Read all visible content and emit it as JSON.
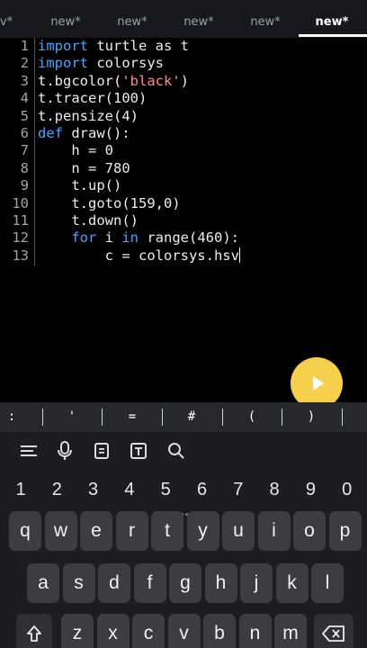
{
  "tabs": [
    {
      "label": "v*"
    },
    {
      "label": "new*"
    },
    {
      "label": "new*"
    },
    {
      "label": "new*"
    },
    {
      "label": "new*"
    },
    {
      "label": "new*",
      "active": true
    }
  ],
  "editor": {
    "lines": [
      {
        "n": "1",
        "parts": [
          {
            "t": "import",
            "c": "kw"
          },
          {
            "t": " turtle as t"
          }
        ]
      },
      {
        "n": "2",
        "parts": [
          {
            "t": "import",
            "c": "kw"
          },
          {
            "t": " colorsys"
          }
        ]
      },
      {
        "n": "3",
        "parts": [
          {
            "t": "t.bgcolor("
          },
          {
            "t": "'black'",
            "c": "str"
          },
          {
            "t": ")"
          }
        ]
      },
      {
        "n": "4",
        "parts": [
          {
            "t": "t.tracer(100)"
          }
        ]
      },
      {
        "n": "5",
        "parts": [
          {
            "t": "t.pensize(4)"
          }
        ]
      },
      {
        "n": "6",
        "parts": [
          {
            "t": "def",
            "c": "kw"
          },
          {
            "t": " draw():"
          }
        ]
      },
      {
        "n": "7",
        "parts": [
          {
            "t": "    h = 0"
          }
        ]
      },
      {
        "n": "8",
        "parts": [
          {
            "t": "    n = 780"
          }
        ]
      },
      {
        "n": "9",
        "parts": [
          {
            "t": "    t.up()"
          }
        ]
      },
      {
        "n": "10",
        "parts": [
          {
            "t": "    t.goto(159,0)"
          }
        ]
      },
      {
        "n": "11",
        "parts": [
          {
            "t": "    t.down()"
          }
        ]
      },
      {
        "n": "12",
        "parts": [
          {
            "t": "    "
          },
          {
            "t": "for",
            "c": "kw"
          },
          {
            "t": " i "
          },
          {
            "t": "in",
            "c": "kw"
          },
          {
            "t": " range(460):"
          }
        ]
      },
      {
        "n": "13",
        "parts": [
          {
            "t": "        c = colorsys.hsv"
          }
        ],
        "cursor": true
      }
    ]
  },
  "run_button": {
    "icon": "play-icon",
    "color": "#f6d04d"
  },
  "symbols": [
    ":",
    "'",
    "=",
    "#",
    "(",
    ")"
  ],
  "keyboard": {
    "tools": [
      "menu-icon",
      "microphone-icon",
      "clipboard-icon",
      "text-icon",
      "search-icon"
    ],
    "numbers": [
      "1",
      "2",
      "3",
      "4",
      "5",
      "6",
      "7",
      "8",
      "9",
      "0"
    ],
    "row1": [
      "q",
      "w",
      "e",
      "r",
      "t",
      "y",
      "u",
      "i",
      "o",
      "p"
    ],
    "row2": [
      "a",
      "s",
      "d",
      "f",
      "g",
      "h",
      "j",
      "k",
      "l"
    ],
    "row3": [
      "z",
      "x",
      "c",
      "v",
      "b",
      "n",
      "m"
    ],
    "shift_icon": "shift-arrow-icon",
    "backspace_icon": "backspace-icon"
  },
  "colors": {
    "keyword": "#4aa3ff",
    "string": "#ff8c8c",
    "accent": "#f6d04d"
  }
}
